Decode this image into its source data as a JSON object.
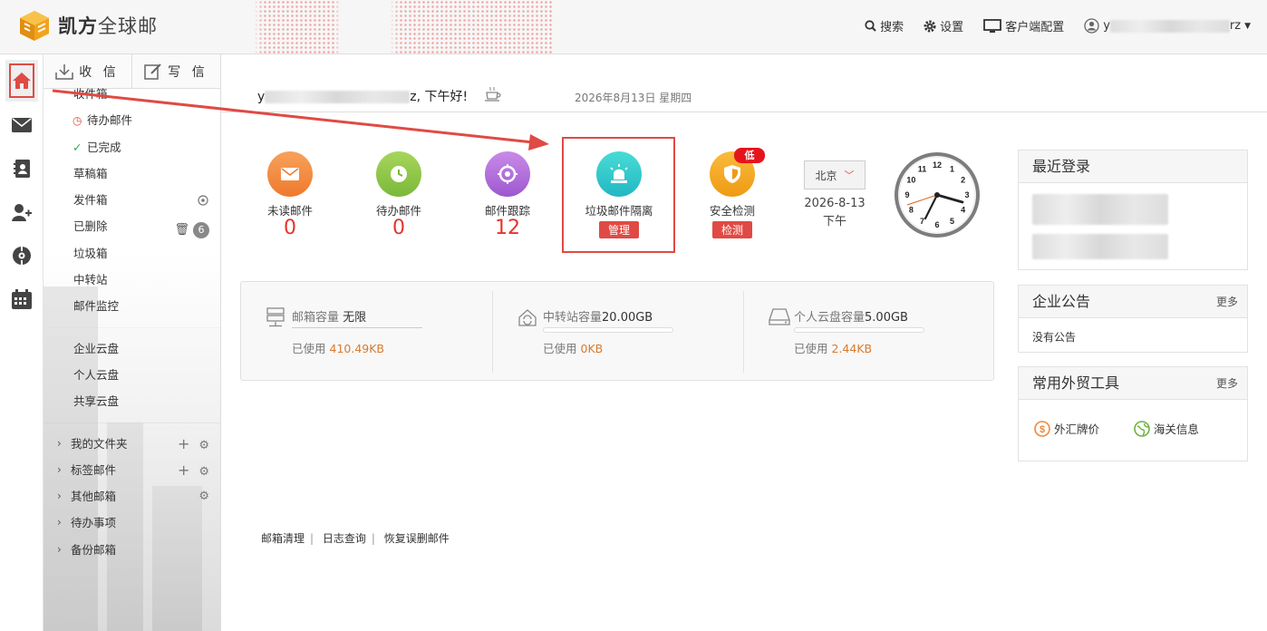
{
  "app": {
    "logo_bold": "凯方",
    "logo_rest": "全球邮"
  },
  "topbar": {
    "search": "搜索",
    "settings": "设置",
    "client_config": "客户端配置",
    "user_start": "y",
    "user_end": "rz"
  },
  "mail_tabs": {
    "receive": "收 信",
    "write": "写 信"
  },
  "folders": [
    "收件箱",
    "待办邮件",
    "已完成",
    "草稿箱",
    "发件箱",
    "已删除",
    "垃圾箱",
    "中转站",
    "邮件监控"
  ],
  "deleted_count": "6",
  "clouds": [
    "企业云盘",
    "个人云盘",
    "共享云盘"
  ],
  "groups": [
    "我的文件夹",
    "标签邮件",
    "其他邮箱",
    "待办事项",
    "备份邮箱"
  ],
  "header": {
    "greet_start": "y",
    "greet_end": "z, 下午好!",
    "date": "2026年8月13日 星期四"
  },
  "stats": [
    {
      "label": "未读邮件",
      "value": "0",
      "color": "#f0883a"
    },
    {
      "label": "待办邮件",
      "value": "0",
      "color": "#8dc63f"
    },
    {
      "label": "邮件跟踪",
      "value": "12",
      "color": "#b067d9"
    },
    {
      "label": "垃圾邮件隔离",
      "tag": "管理",
      "color": "#2ec4c6"
    },
    {
      "label": "安全检测",
      "tag": "检测",
      "color": "#f2a125",
      "badge": "低"
    }
  ],
  "weather": {
    "city": "北京",
    "date": "2026-8-13",
    "period": "下午"
  },
  "capacity": [
    {
      "label": "邮箱容量",
      "total": "无限",
      "used_label": "已使用",
      "used": "410.49KB",
      "fraction": 0
    },
    {
      "label": "中转站容量",
      "total": "20.00GB",
      "used_label": "已使用",
      "used": "0KB",
      "fraction": 0
    },
    {
      "label": "个人云盘容量",
      "total": "5.00GB",
      "used_label": "已使用",
      "used": "2.44KB",
      "fraction": 0
    }
  ],
  "footer_links": [
    "邮箱清理",
    "日志查询",
    "恢复误删邮件"
  ],
  "panels": {
    "recent_login": "最近登录",
    "notice": {
      "title": "企业公告",
      "more": "更多",
      "empty": "没有公告"
    },
    "tools": {
      "title": "常用外贸工具",
      "more": "更多",
      "items": [
        "外汇牌价",
        "海关信息"
      ]
    }
  },
  "clock_numbers": [
    "12",
    "1",
    "2",
    "3",
    "4",
    "5",
    "6",
    "7",
    "8",
    "9",
    "10",
    "11"
  ],
  "colors": {
    "accent": "#e04a44",
    "number": "#e5342e",
    "used": "#d87a2f"
  }
}
